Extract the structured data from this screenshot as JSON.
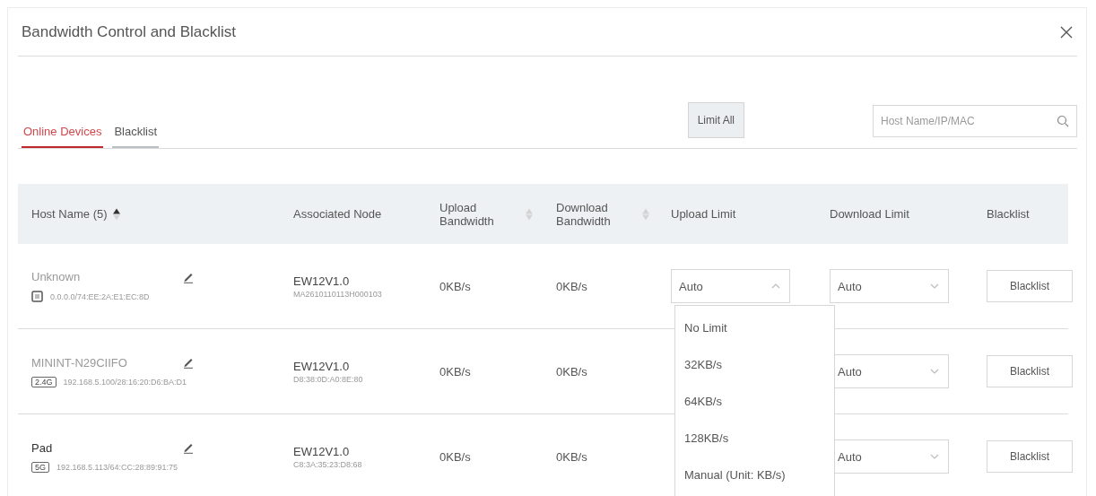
{
  "dialog": {
    "title": "Bandwidth Control and Blacklist"
  },
  "tabs": [
    {
      "label": "Online Devices",
      "selected": true
    },
    {
      "label": "Blacklist",
      "selected": false
    }
  ],
  "limit_all_button": "Limit All",
  "search": {
    "placeholder": "Host Name/IP/MAC"
  },
  "table": {
    "columns": [
      {
        "label": "Host Name (5)",
        "sortable": true,
        "sorted": true
      },
      {
        "label": "Associated Node",
        "sortable": false
      },
      {
        "label": "Upload Bandwidth",
        "sortable": true,
        "sorted": false
      },
      {
        "label": "Download Bandwidth",
        "sortable": true,
        "sorted": false
      },
      {
        "label": "Upload Limit",
        "sortable": false
      },
      {
        "label": "Download Limit",
        "sortable": false
      },
      {
        "label": "Blacklist",
        "sortable": false
      }
    ],
    "rows": [
      {
        "host": "Unknown",
        "dimmed": true,
        "badge": {
          "kind": "device"
        },
        "address": "0.0.0.0/74:EE:2A:E1:EC:8D",
        "node": "EW12V1.0",
        "node_id": "MA2610110113H000103",
        "upload": "0KB/s",
        "download": "0KB/s",
        "upload_limit": {
          "value": "Auto",
          "expanded": true
        },
        "download_limit": {
          "value": "Auto",
          "expanded": false
        },
        "action": "Blacklist"
      },
      {
        "host": "MININT-N29CIIFO",
        "dimmed": true,
        "badge": {
          "kind": "band",
          "text": "2.4G"
        },
        "address": "192.168.5.100/28:16:20:D6:BA:D1",
        "node": "EW12V1.0",
        "node_id": "D8:38:0D:A0:8E:80",
        "upload": "0KB/s",
        "download": "0KB/s",
        "download_limit": {
          "value": "Auto",
          "expanded": false
        },
        "action": "Blacklist"
      },
      {
        "host": "Pad",
        "dimmed": false,
        "badge": {
          "kind": "band",
          "text": "5G"
        },
        "address": "192.168.5.113/64:CC:28:89:91:75",
        "node": "EW12V1.0",
        "node_id": "C8:3A:35:23:D8:68",
        "upload": "0KB/s",
        "download": "0KB/s",
        "download_limit": {
          "value": "Auto",
          "expanded": false
        },
        "action": "Blacklist"
      }
    ]
  },
  "dropdown_options": [
    "No Limit",
    "32KB/s",
    "64KB/s",
    "128KB/s",
    "Manual (Unit: KB/s)"
  ]
}
